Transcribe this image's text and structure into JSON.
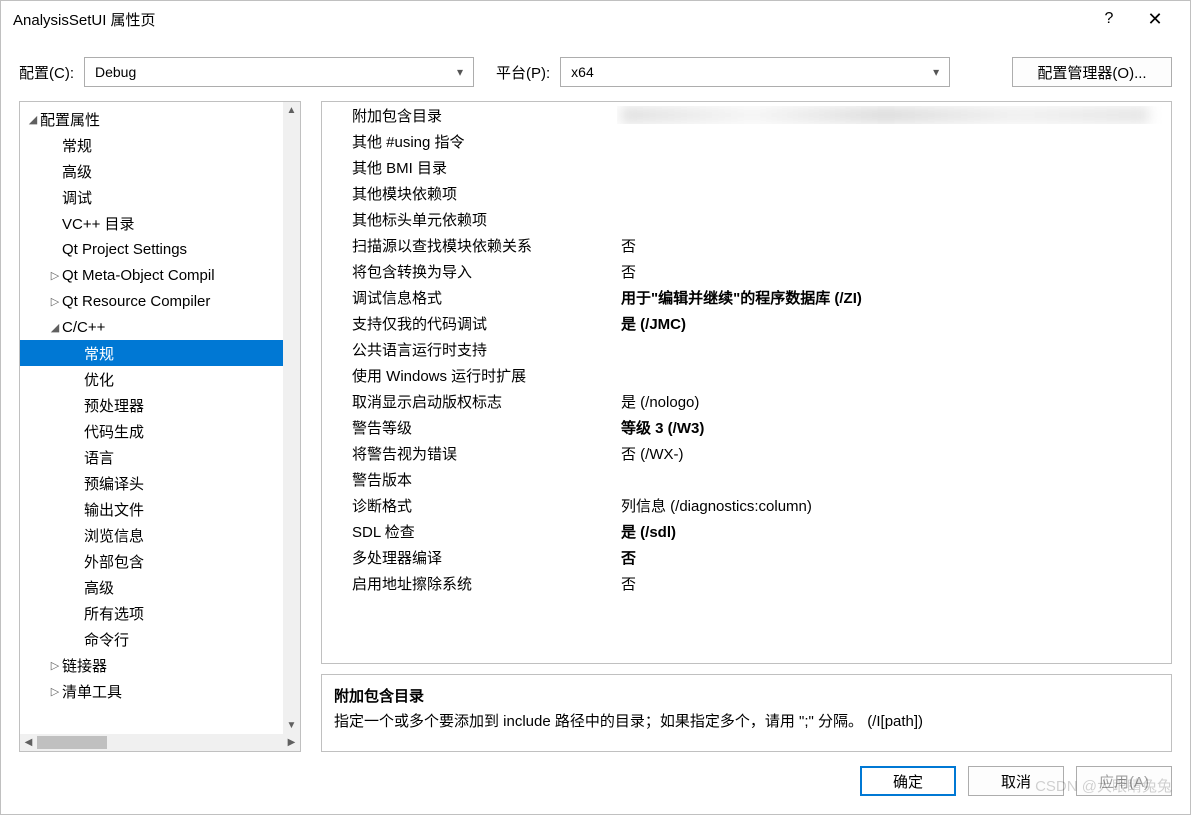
{
  "title": "AnalysisSetUI 属性页",
  "config_label": "配置(C):",
  "config_value": "Debug",
  "platform_label": "平台(P):",
  "platform_value": "x64",
  "config_mgr_label": "配置管理器(O)...",
  "tree": {
    "root": "配置属性",
    "items": [
      {
        "label": "常规",
        "depth": 1
      },
      {
        "label": "高级",
        "depth": 1
      },
      {
        "label": "调试",
        "depth": 1
      },
      {
        "label": "VC++ 目录",
        "depth": 1
      },
      {
        "label": "Qt Project Settings",
        "depth": 1
      },
      {
        "label": "Qt Meta-Object Compil",
        "depth": 1,
        "twisty": "▷"
      },
      {
        "label": "Qt Resource Compiler",
        "depth": 1,
        "twisty": "▷"
      },
      {
        "label": "C/C++",
        "depth": 1,
        "twisty": "◢"
      },
      {
        "label": "常规",
        "depth": 2,
        "selected": true
      },
      {
        "label": "优化",
        "depth": 2
      },
      {
        "label": "预处理器",
        "depth": 2
      },
      {
        "label": "代码生成",
        "depth": 2
      },
      {
        "label": "语言",
        "depth": 2
      },
      {
        "label": "预编译头",
        "depth": 2
      },
      {
        "label": "输出文件",
        "depth": 2
      },
      {
        "label": "浏览信息",
        "depth": 2
      },
      {
        "label": "外部包含",
        "depth": 2
      },
      {
        "label": "高级",
        "depth": 2
      },
      {
        "label": "所有选项",
        "depth": 2
      },
      {
        "label": "命令行",
        "depth": 2
      },
      {
        "label": "链接器",
        "depth": 1,
        "twisty": "▷"
      },
      {
        "label": "清单工具",
        "depth": 1,
        "twisty": "▷"
      }
    ]
  },
  "props": [
    {
      "name": "附加包含目录",
      "value": "",
      "blurred": true
    },
    {
      "name": "其他 #using 指令",
      "value": ""
    },
    {
      "name": "其他 BMI 目录",
      "value": ""
    },
    {
      "name": "其他模块依赖项",
      "value": ""
    },
    {
      "name": "其他标头单元依赖项",
      "value": ""
    },
    {
      "name": "扫描源以查找模块依赖关系",
      "value": "否"
    },
    {
      "name": "将包含转换为导入",
      "value": "否"
    },
    {
      "name": "调试信息格式",
      "value": "用于\"编辑并继续\"的程序数据库 (/ZI)",
      "bold": true
    },
    {
      "name": "支持仅我的代码调试",
      "value": "是 (/JMC)",
      "bold": true
    },
    {
      "name": "公共语言运行时支持",
      "value": ""
    },
    {
      "name": "使用 Windows 运行时扩展",
      "value": ""
    },
    {
      "name": "取消显示启动版权标志",
      "value": "是 (/nologo)"
    },
    {
      "name": "警告等级",
      "value": "等级 3 (/W3)",
      "bold": true
    },
    {
      "name": "将警告视为错误",
      "value": "否 (/WX-)"
    },
    {
      "name": "警告版本",
      "value": ""
    },
    {
      "name": "诊断格式",
      "value": "列信息 (/diagnostics:column)"
    },
    {
      "name": "SDL 检查",
      "value": "是 (/sdl)",
      "bold": true
    },
    {
      "name": "多处理器编译",
      "value": "否",
      "bold": true
    },
    {
      "name": "启用地址擦除系统",
      "value": "否"
    }
  ],
  "desc": {
    "title": "附加包含目录",
    "text": "指定一个或多个要添加到 include 路径中的目录；如果指定多个，请用 \";\" 分隔。  (/I[path])"
  },
  "buttons": {
    "ok": "确定",
    "cancel": "取消",
    "apply": "应用(A)"
  },
  "watermark": "CSDN @大眼睛兔兔"
}
